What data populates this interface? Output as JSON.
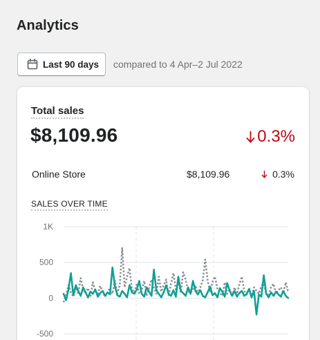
{
  "page": {
    "title": "Analytics"
  },
  "toolbar": {
    "date_range_label": "Last 90 days",
    "date_icon": "calendar-icon",
    "compare_text": "compared to 4 Apr–2 Jul 2022"
  },
  "card": {
    "title": "Total sales",
    "total_value": "$8,109.96",
    "total_change": "0.3%",
    "change_icon": "arrow-down-icon",
    "colors": {
      "negative": "#bf0711",
      "current_series": "#10a095",
      "previous_series": "#8c9196"
    },
    "breakdown": [
      {
        "channel": "Online Store",
        "amount": "$8,109.96",
        "change": "0.3%"
      }
    ],
    "section_label": "SALES OVER TIME"
  },
  "chart_data": {
    "type": "line",
    "grid": true,
    "ylim": [
      -500,
      1000
    ],
    "yticks": [
      "1K",
      "500",
      "0",
      "-500"
    ],
    "ytick_values": [
      1000,
      500,
      0,
      -500
    ],
    "series": [
      {
        "values": [
          60,
          -30,
          120,
          350,
          40,
          180,
          100,
          30,
          150,
          80,
          10,
          90,
          60,
          120,
          20,
          70,
          100,
          30,
          80,
          50,
          430,
          170,
          40,
          20,
          100,
          60,
          10,
          180,
          80,
          60,
          120,
          240,
          60,
          20,
          150,
          90,
          30,
          400,
          110,
          60,
          10,
          80,
          180,
          60,
          30,
          110,
          20,
          300,
          100,
          70,
          30,
          150,
          60,
          240,
          100,
          50,
          110,
          30,
          10,
          80,
          160,
          40,
          70,
          10,
          140,
          90,
          20,
          210,
          110,
          30,
          100,
          20,
          70,
          100,
          30,
          60,
          130,
          10,
          100,
          -230,
          50,
          20,
          320,
          60,
          10,
          80,
          30,
          90,
          50,
          20,
          100,
          30,
          0
        ]
      },
      {
        "values": [
          -60,
          40,
          180,
          80,
          20,
          150,
          60,
          280,
          120,
          60,
          140,
          30,
          220,
          100,
          50,
          170,
          90,
          20,
          80,
          140,
          60,
          240,
          60,
          180,
          700,
          150,
          300,
          420,
          120,
          80,
          200,
          60,
          110,
          240,
          30,
          140,
          260,
          140,
          60,
          300,
          90,
          180,
          260,
          40,
          200,
          350,
          120,
          220,
          80,
          360,
          260,
          100,
          70,
          130,
          180,
          60,
          150,
          250,
          540,
          250,
          80,
          230,
          300,
          130,
          80,
          30,
          220,
          60,
          120,
          20,
          150,
          60,
          190,
          300,
          100,
          50,
          120,
          10,
          150,
          100,
          60,
          170,
          200,
          60,
          30,
          160,
          200,
          60,
          110,
          150,
          70,
          220,
          80
        ]
      }
    ]
  }
}
